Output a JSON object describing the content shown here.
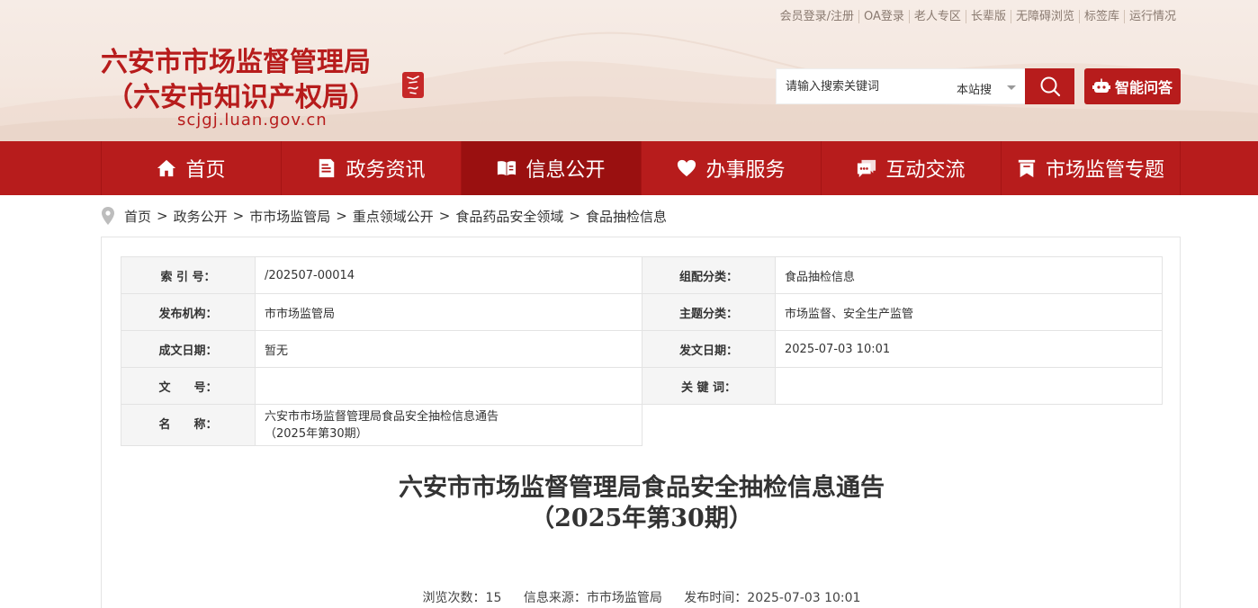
{
  "top_links": [
    "会员登录/注册",
    "OA登录",
    "老人专区",
    "长辈版",
    "无障碍浏览",
    "标签库",
    "运行情况"
  ],
  "logo": {
    "line1": "六安市市场监督管理局",
    "line2": "（六安市知识产权局）",
    "url": "scjgj.luan.gov.cn",
    "seal_icon": "city-seal-icon"
  },
  "search": {
    "placeholder": "请输入搜索关键词",
    "scope": "本站搜",
    "button_icon": "search-icon"
  },
  "ai_button": {
    "label": "智能问答",
    "icon": "robot-icon"
  },
  "nav": [
    {
      "label": "首页",
      "icon": "home-icon",
      "active": false
    },
    {
      "label": "政务资讯",
      "icon": "document-icon",
      "active": false
    },
    {
      "label": "信息公开",
      "icon": "open-book-icon",
      "active": true
    },
    {
      "label": "办事服务",
      "icon": "heart-icon",
      "active": false
    },
    {
      "label": "互动交流",
      "icon": "chat-icon",
      "active": false
    },
    {
      "label": "市场监管专题",
      "icon": "bookmark-icon",
      "active": false
    }
  ],
  "breadcrumb": [
    "首页",
    "政务公开",
    "市市场监管局",
    "重点领域公开",
    "食品药品安全领域",
    "食品抽检信息"
  ],
  "meta": {
    "index_label": "索 引 号：",
    "index_value": "/202507-00014",
    "category_label": "组配分类：",
    "category_value": "食品抽检信息",
    "publisher_label": "发布机构：",
    "publisher_value": "市市场监管局",
    "topic_label": "主题分类：",
    "topic_value": "市场监督、安全生产监管",
    "created_label": "成文日期：",
    "created_value": "暂无",
    "issued_label": "发文日期：",
    "issued_value": "2025-07-03 10:01",
    "docno_label": "文　　号：",
    "docno_value": "",
    "keywords_label": "关 键 词：",
    "keywords_value": "",
    "name_label": "名　　称：",
    "name_value_line1": "六安市市场监督管理局食品安全抽检信息通告",
    "name_value_line2": "（2025年第30期）"
  },
  "article": {
    "title_line1": "六安市市场监督管理局食品安全抽检信息通告",
    "title_line2": "（2025年第30期）",
    "views": "浏览次数：15",
    "source": "信息来源：市市场监管局",
    "published": "发布时间：2025-07-03 10:01"
  },
  "colors": {
    "brand_red": "#b71c1c",
    "nav_active": "#9a1010"
  }
}
